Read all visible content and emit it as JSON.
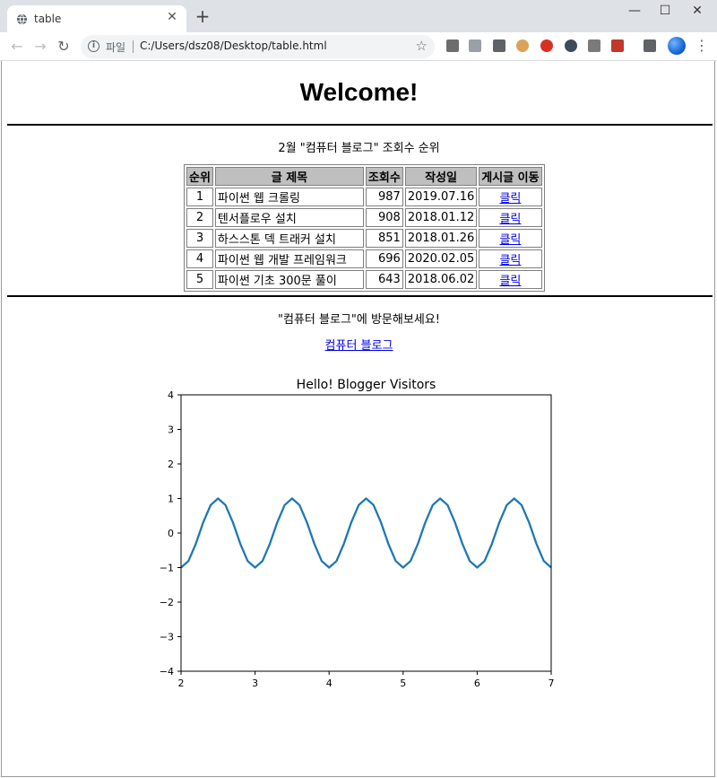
{
  "browser": {
    "tab_title": "table",
    "omnibox": {
      "scheme_label": "파일",
      "url": "C:/Users/dsz08/Desktop/table.html"
    }
  },
  "page": {
    "heading": "Welcome!",
    "table_caption": "2월 \"컴퓨터 블로그\" 조회수 순위",
    "table": {
      "headers": [
        "순위",
        "글 제목",
        "조회수",
        "작성일",
        "게시글 이동"
      ],
      "rows": [
        {
          "rank": "1",
          "title": "파이썬 웹 크롤링",
          "views": "987",
          "date": "2019.07.16",
          "link": "클릭"
        },
        {
          "rank": "2",
          "title": "텐서플로우 설치",
          "views": "908",
          "date": "2018.01.12",
          "link": "클릭"
        },
        {
          "rank": "3",
          "title": "하스스톤 덱 트래커 설치",
          "views": "851",
          "date": "2018.01.26",
          "link": "클릭"
        },
        {
          "rank": "4",
          "title": "파이썬 웹 개발 프레임워크",
          "views": "696",
          "date": "2020.02.05",
          "link": "클릭"
        },
        {
          "rank": "5",
          "title": "파이썬 기초 300문 풀이",
          "views": "643",
          "date": "2018.06.02",
          "link": "클릭"
        }
      ]
    },
    "visit_caption": "\"컴퓨터 블로그\"에 방문해보세요!",
    "blog_link": "컴퓨터 블로그"
  },
  "chart_data": {
    "type": "line",
    "title": "Hello! Blogger Visitors",
    "xlabel": "",
    "ylabel": "",
    "xlim": [
      2,
      7
    ],
    "ylim": [
      -4,
      4
    ],
    "xticks": [
      2,
      3,
      4,
      5,
      6,
      7
    ],
    "yticks": [
      -4,
      -3,
      -2,
      -1,
      0,
      1,
      2,
      3,
      4
    ],
    "grid": false,
    "series": [
      {
        "color": "#1f77b4",
        "x": [
          2.0,
          2.1,
          2.2,
          2.3,
          2.4,
          2.5,
          2.6,
          2.7,
          2.8,
          2.9,
          3.0,
          3.1,
          3.2,
          3.3,
          3.4,
          3.5,
          3.6,
          3.7,
          3.8,
          3.9,
          4.0,
          4.1,
          4.2,
          4.3,
          4.4,
          4.5,
          4.6,
          4.7,
          4.8,
          4.9,
          5.0,
          5.1,
          5.2,
          5.3,
          5.4,
          5.5,
          5.6,
          5.7,
          5.8,
          5.9,
          6.0,
          6.1,
          6.2,
          6.3,
          6.4,
          6.5,
          6.6,
          6.7,
          6.8,
          6.9,
          7.0
        ],
        "y": [
          -1.0,
          -0.81,
          -0.31,
          0.31,
          0.81,
          1.0,
          0.81,
          0.31,
          -0.31,
          -0.81,
          -1.0,
          -0.81,
          -0.31,
          0.31,
          0.81,
          1.0,
          0.81,
          0.31,
          -0.31,
          -0.81,
          -1.0,
          -0.81,
          -0.31,
          0.31,
          0.81,
          1.0,
          0.81,
          0.31,
          -0.31,
          -0.81,
          -1.0,
          -0.81,
          -0.31,
          0.31,
          0.81,
          1.0,
          0.81,
          0.31,
          -0.31,
          -0.81,
          -1.0,
          -0.81,
          -0.31,
          0.31,
          0.81,
          1.0,
          0.81,
          0.31,
          -0.31,
          -0.81,
          -1.0
        ]
      }
    ]
  }
}
